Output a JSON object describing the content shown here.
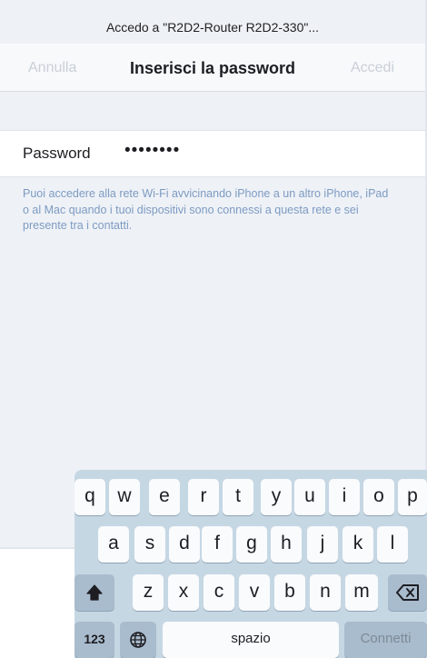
{
  "status": {
    "title": "Accedo a \"R2D2-Router R2D2-330\"..."
  },
  "nav": {
    "cancel_label": "Annulla",
    "title": "Inserisci la password",
    "join_label": "Accedi"
  },
  "password": {
    "label": "Password",
    "value": "••••••••"
  },
  "info": {
    "text": "Puoi accedere alla rete Wi-Fi avvicinando iPhone a un altro iPhone, iPad o al Mac quando i tuoi dispositivi sono connessi a questa rete e sei presente tra i contatti."
  },
  "keyboard": {
    "row1": [
      "q",
      "w",
      "e",
      "r",
      "t",
      "y",
      "u",
      "i",
      "o",
      "p"
    ],
    "row2": [
      "a",
      "s",
      "d",
      "f",
      "g",
      "h",
      "j",
      "k",
      "l"
    ],
    "row3": [
      "z",
      "x",
      "c",
      "v",
      "b",
      "n",
      "m"
    ],
    "shift_icon": "shift-arrow-icon",
    "delete_icon": "delete-backspace-icon",
    "globe_icon": "globe-icon",
    "numbers_label": "123",
    "space_label": "spazio",
    "go_label": "Connetti"
  }
}
